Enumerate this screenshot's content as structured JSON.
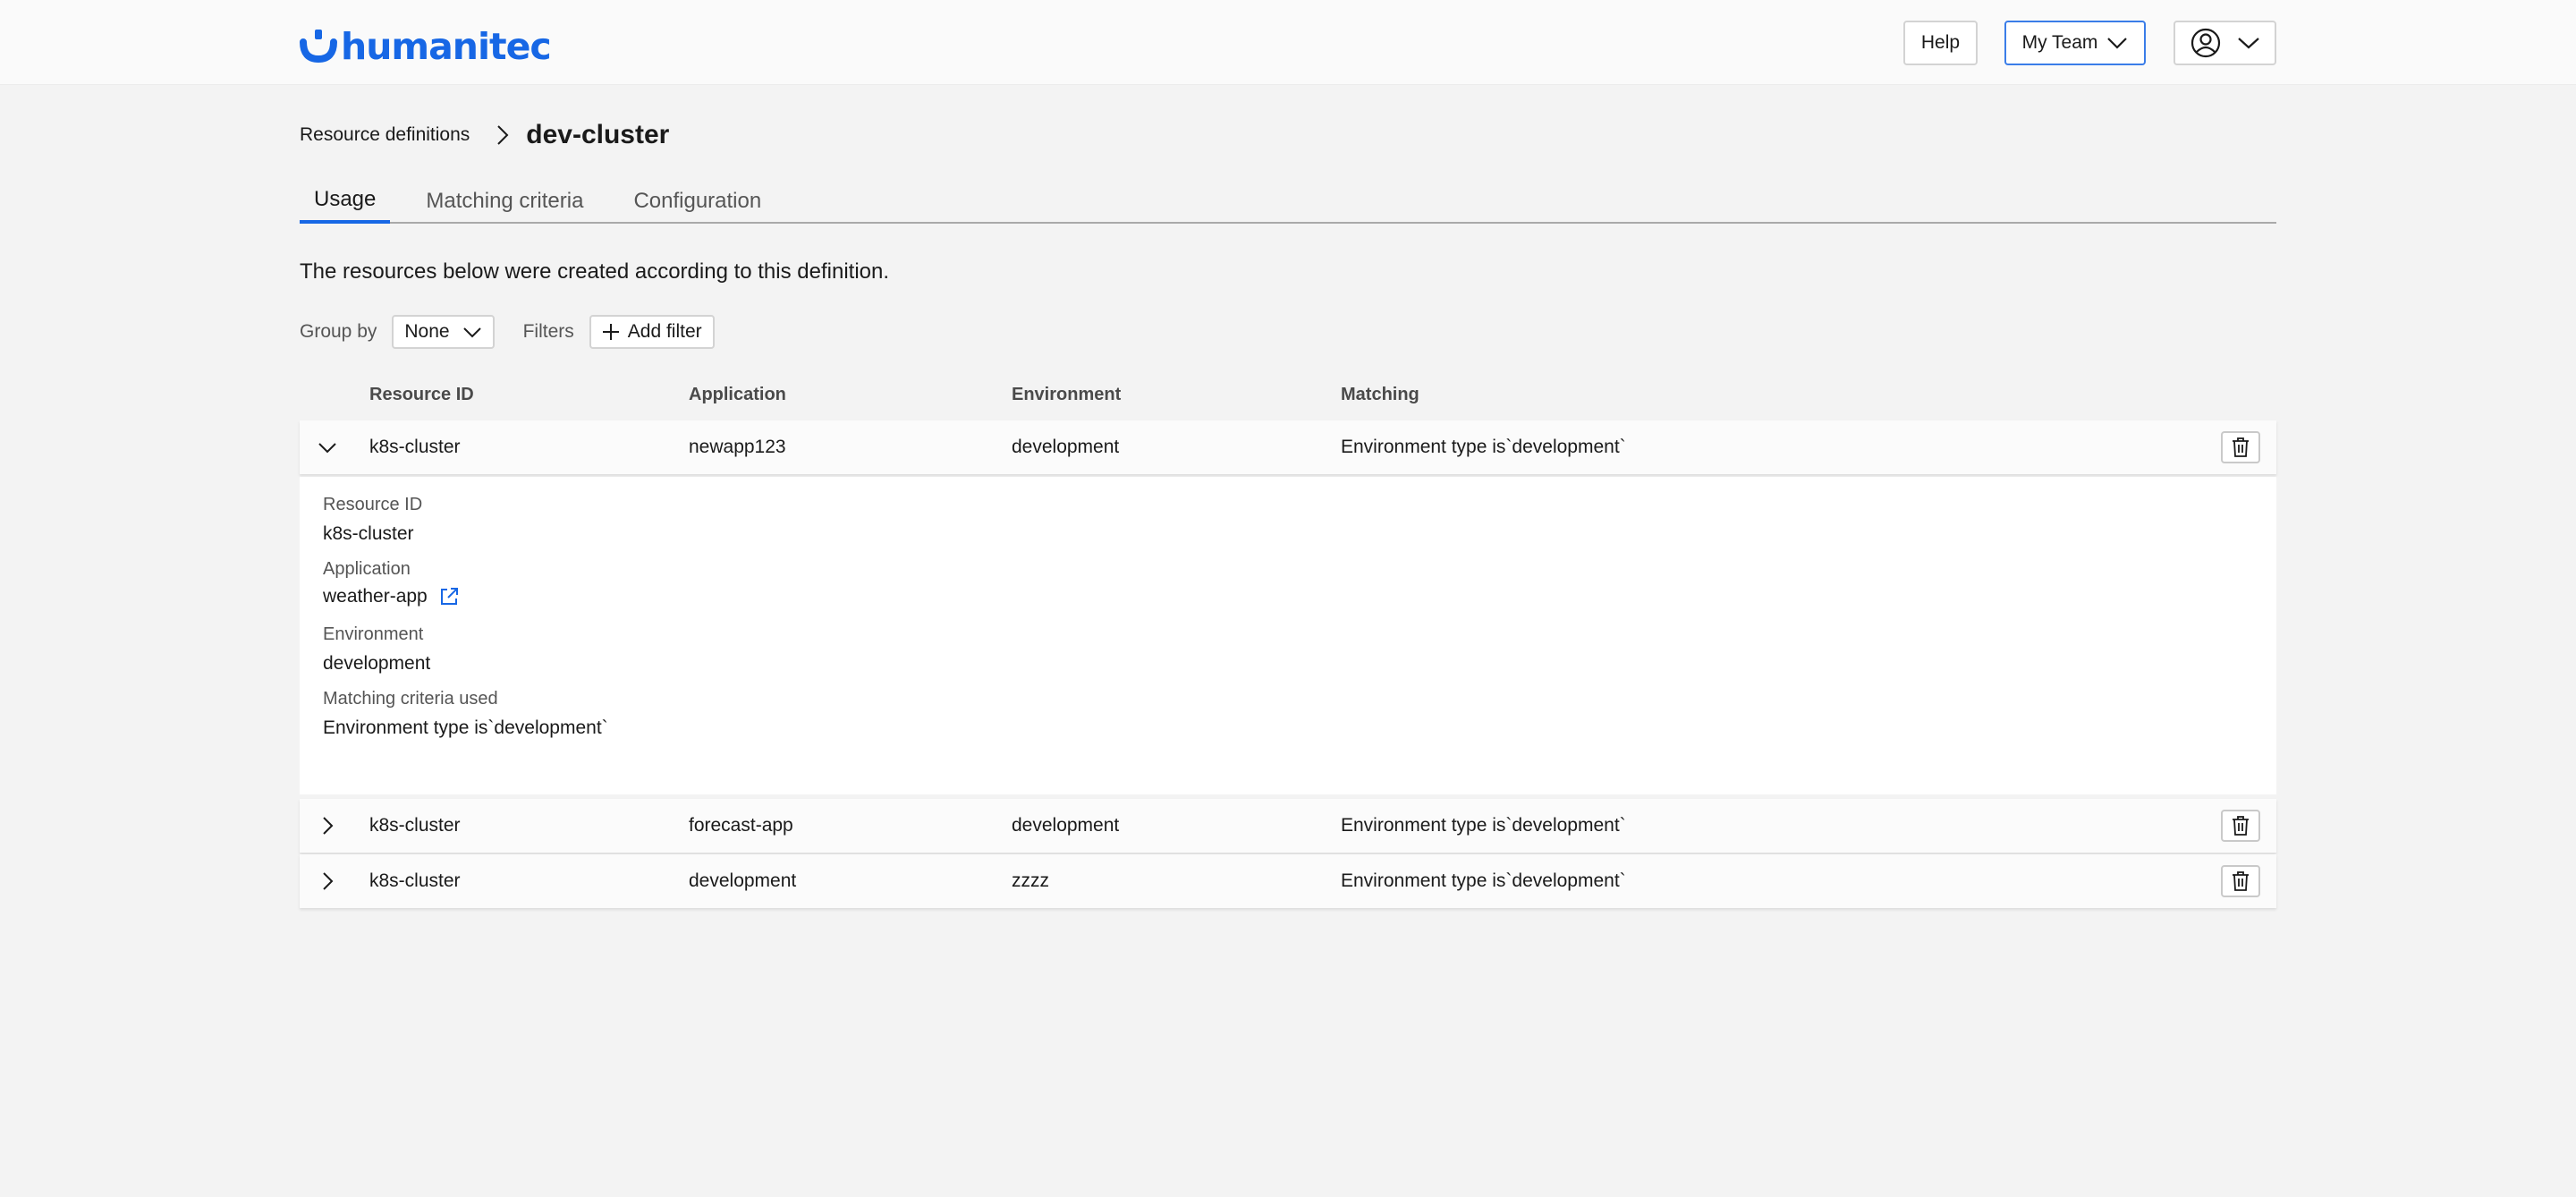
{
  "brand": {
    "logo_text": "humanitec",
    "color": "#1767e5"
  },
  "header": {
    "help_label": "Help",
    "team_label": "My Team",
    "user_icon": "user-circle-icon",
    "dropdown_icon": "chevron-down-icon"
  },
  "breadcrumb": {
    "parent": "Resource definitions",
    "separator_icon": "chevron-right-icon",
    "current": "dev-cluster"
  },
  "tabs": [
    {
      "label": "Usage",
      "active": true
    },
    {
      "label": "Matching criteria",
      "active": false
    },
    {
      "label": "Configuration",
      "active": false
    }
  ],
  "description": "The resources below were created according to this definition.",
  "filters": {
    "group_by_label": "Group by",
    "group_by_value": "None",
    "filters_label": "Filters",
    "add_filter_label": "Add filter"
  },
  "table": {
    "columns": [
      "Resource ID",
      "Application",
      "Environment",
      "Matching"
    ],
    "rows": [
      {
        "resource_id": "k8s-cluster",
        "application": "newapp123",
        "environment": "development",
        "matching": "Environment type is`development`",
        "expanded": true
      },
      {
        "resource_id": "k8s-cluster",
        "application": "forecast-app",
        "environment": "development",
        "matching": "Environment type is`development`",
        "expanded": false
      },
      {
        "resource_id": "k8s-cluster",
        "application": "development",
        "environment": "zzzz",
        "matching": "Environment type is`development`",
        "expanded": false
      }
    ],
    "detail": {
      "resource_id_label": "Resource ID",
      "resource_id_value": "k8s-cluster",
      "application_label": "Application",
      "application_value": "weather-app",
      "environment_label": "Environment",
      "environment_value": "development",
      "criteria_label": "Matching criteria used",
      "criteria_value": "Environment type is`development`"
    }
  }
}
